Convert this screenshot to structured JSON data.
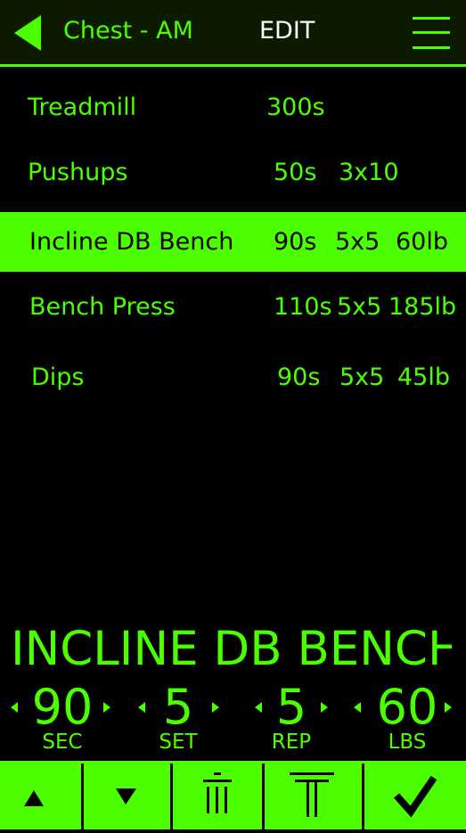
{
  "header": {
    "title": "Chest - AM",
    "edit_label": "EDIT"
  },
  "exercises": [
    {
      "name": "Treadmill",
      "rest": "300s",
      "sets": "",
      "weight": ""
    },
    {
      "name": "Pushups",
      "rest": "50s",
      "sets": "3x10",
      "weight": ""
    },
    {
      "name": "Incline DB Bench",
      "rest": "90s",
      "sets": "5x5",
      "weight": "60lb",
      "selected": true
    },
    {
      "name": "Bench Press",
      "rest": "110s",
      "sets": "5x5",
      "weight": "185lb"
    },
    {
      "name": "Dips",
      "rest": "90s",
      "sets": "5x5",
      "weight": "45lb"
    }
  ],
  "editor": {
    "exercise_name": "INCLINE DB BENCH",
    "steppers": [
      {
        "value": "90",
        "unit": "SEC"
      },
      {
        "value": "5",
        "unit": "SET"
      },
      {
        "value": "5",
        "unit": "REP"
      },
      {
        "value": "60",
        "unit": "LBS"
      }
    ]
  },
  "toolbar": {
    "icons": [
      "move-up-icon",
      "move-down-icon",
      "delete-icon",
      "insert-icon",
      "confirm-icon"
    ]
  },
  "colors": {
    "accent": "#4cff00",
    "header_bg": "#0c1a00",
    "background": "#000000",
    "edit_text": "#ffffff"
  }
}
